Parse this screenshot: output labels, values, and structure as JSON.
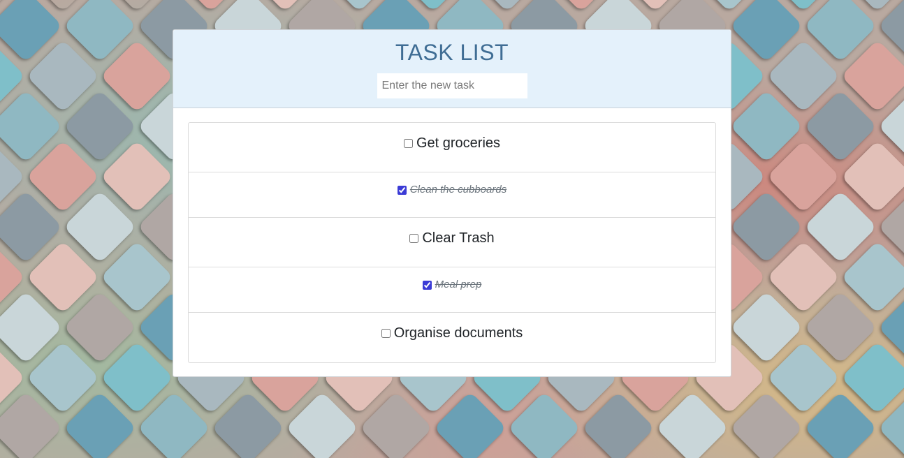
{
  "header": {
    "title": "TASK LIST",
    "input_placeholder": "Enter the new task",
    "input_value": ""
  },
  "tasks": [
    {
      "label": "Get groceries",
      "completed": false
    },
    {
      "label": "Clean the cubboards",
      "completed": true
    },
    {
      "label": "Clear Trash",
      "completed": false
    },
    {
      "label": "Meal prep",
      "completed": true
    },
    {
      "label": "Organise documents",
      "completed": false
    }
  ],
  "colors": {
    "header_bg": "#e4f1fb",
    "title": "#3f6d94",
    "checkbox_accent": "#3b3bd6"
  }
}
